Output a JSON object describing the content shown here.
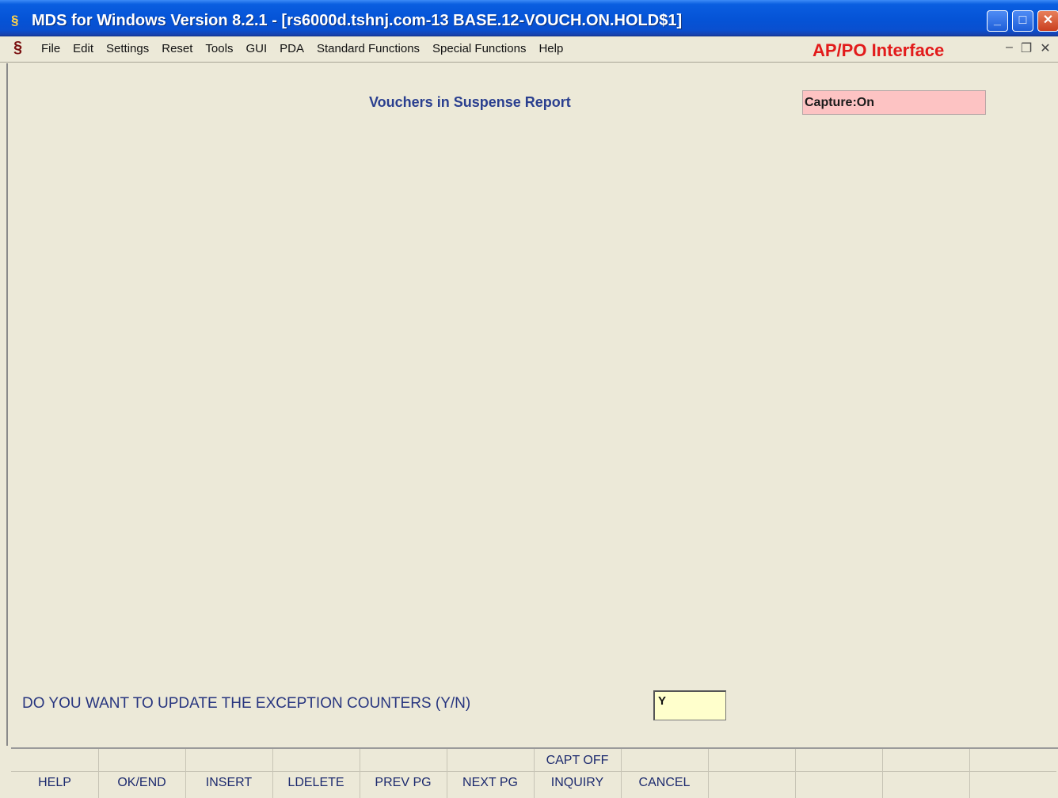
{
  "window": {
    "title": "MDS for Windows Version 8.2.1 - [rs6000d.tshnj.com-13 BASE.12-VOUCH.ON.HOLD$1]",
    "icon": "app-logo-icon"
  },
  "menu": {
    "items": [
      "File",
      "Edit",
      "Settings",
      "Reset",
      "Tools",
      "GUI",
      "PDA",
      "Standard Functions",
      "Special Functions",
      "Help"
    ],
    "interface_label": "AP/PO Interface"
  },
  "main": {
    "report_title": "Vouchers in Suspense Report",
    "capture_status": "Capture:On",
    "question": "DO YOU WANT TO UPDATE THE EXCEPTION COUNTERS (Y/N)",
    "answer_value": "Y"
  },
  "function_keys": [
    {
      "top": "",
      "bottom": "HELP"
    },
    {
      "top": "",
      "bottom": "OK/END"
    },
    {
      "top": "",
      "bottom": "INSERT"
    },
    {
      "top": "",
      "bottom": "LDELETE"
    },
    {
      "top": "",
      "bottom": "PREV PG"
    },
    {
      "top": "",
      "bottom": "NEXT PG"
    },
    {
      "top": "CAPT OFF",
      "bottom": "INQUIRY"
    },
    {
      "top": "",
      "bottom": "CANCEL"
    },
    {
      "top": "",
      "bottom": ""
    },
    {
      "top": "",
      "bottom": ""
    },
    {
      "top": "",
      "bottom": ""
    },
    {
      "top": "",
      "bottom": ""
    }
  ],
  "colors": {
    "titlebar": "#0553d6",
    "interface_label": "#e21b1b",
    "capture_box": "#fdc3c3",
    "answer_field": "#ffffcc",
    "text_blue": "#27357f"
  }
}
